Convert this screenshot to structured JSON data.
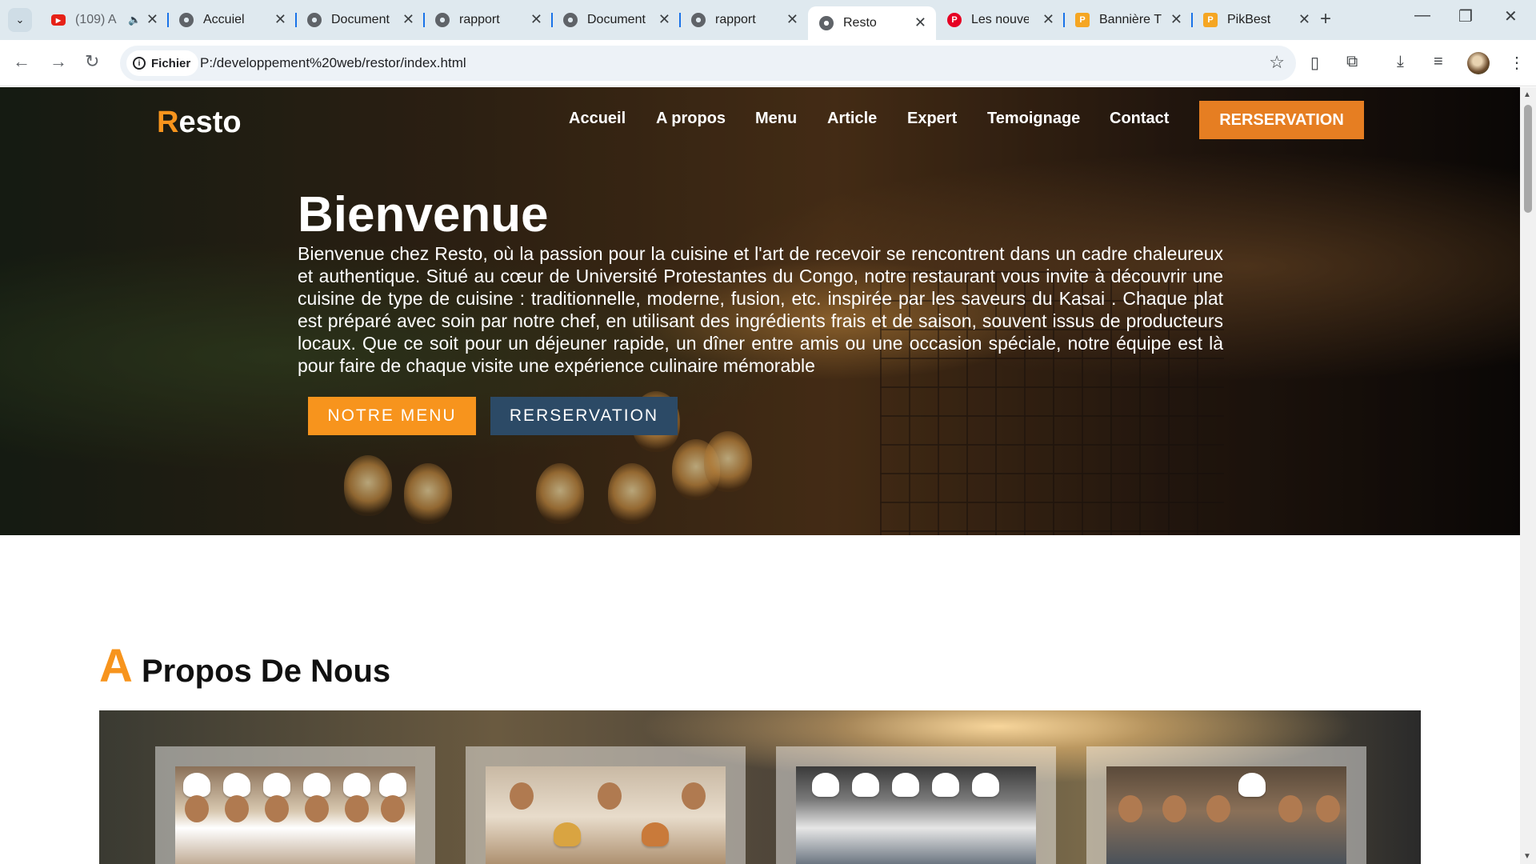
{
  "browser": {
    "tabs": [
      {
        "title": "(109) A",
        "icon": "youtube-icon",
        "active": false
      },
      {
        "title": "Accuiel",
        "icon": "globe-icon",
        "active": false
      },
      {
        "title": "Document",
        "icon": "globe-icon",
        "active": false
      },
      {
        "title": "rapport",
        "icon": "globe-icon",
        "active": false
      },
      {
        "title": "Document",
        "icon": "globe-icon",
        "active": false
      },
      {
        "title": "rapport",
        "icon": "globe-icon",
        "active": false
      },
      {
        "title": "Resto",
        "icon": "globe-icon",
        "active": true
      },
      {
        "title": "Les nouvel",
        "icon": "pinterest-icon",
        "active": false
      },
      {
        "title": "Bannière T",
        "icon": "pikbest-icon",
        "active": false
      },
      {
        "title": "PikBest",
        "icon": "pikbest-icon",
        "active": false
      }
    ],
    "security_chip": "Fichier",
    "url": "P:/developpement%20web/restor/index.html",
    "glyphs": {
      "close": "✕",
      "new_tab": "+",
      "back": "←",
      "forward": "→",
      "reload": "↻",
      "star": "☆",
      "minimize": "—",
      "restore": "❐",
      "window_close": "✕",
      "menu": "⋮",
      "tab_search": "⌄",
      "info": "i",
      "yt_play": "▶",
      "pikbest_letter": "P",
      "pinterest_letter": "P",
      "sound": "🔈",
      "download": "⤓",
      "extensions": "⧉",
      "media": "≡",
      "reading": "▯"
    }
  },
  "site": {
    "logo_first": "R",
    "logo_rest": "esto",
    "nav": [
      "Accueil",
      "A propos",
      "Menu",
      "Article",
      "Expert",
      "Temoignage",
      "Contact"
    ],
    "nav_cta": "RERSERVATION",
    "hero_title": "Bienvenue",
    "hero_text": "Bienvenue chez Resto, où la passion pour la cuisine et l'art de recevoir se rencontrent dans un cadre chaleureux et authentique. Situé au cœur de Université Protestantes du Congo, notre restaurant vous invite à découvrir une cuisine de type de cuisine : traditionnelle, moderne, fusion, etc. inspirée par les saveurs du Kasai . Chaque plat est préparé avec soin par notre chef, en utilisant des ingrédients frais et de saison, souvent issus de producteurs locaux. Que ce soit pour un déjeuner rapide, un dîner entre amis ou une occasion spéciale, notre équipe est là pour faire de chaque visite une expérience culinaire mémorable",
    "hero_btn_menu": "NOTRE MENU",
    "hero_btn_reservation": "RERSERVATION",
    "about_first": "A",
    "about_rest": " Propos De Nous"
  },
  "colors": {
    "accent_orange": "#f7941d",
    "cta_orange": "#e67e22",
    "navy": "#2c4a66"
  }
}
